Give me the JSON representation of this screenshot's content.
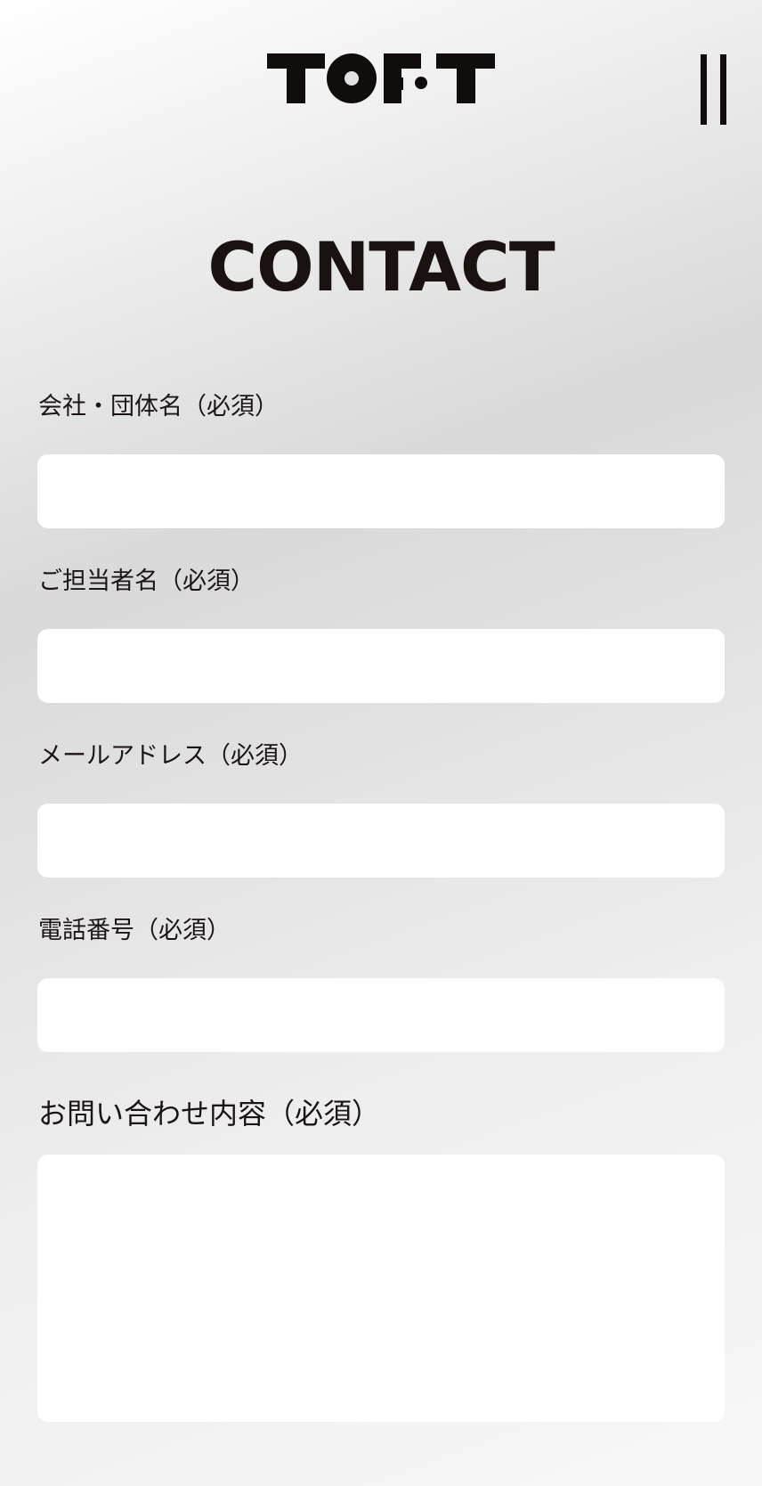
{
  "header": {
    "logo_text": "TOFT",
    "menu_icon": "menu-icon"
  },
  "page": {
    "title": "CONTACT"
  },
  "form": {
    "company": {
      "label": "会社・団体名（必須）",
      "value": "",
      "placeholder": ""
    },
    "contact_person": {
      "label": "ご担当者名（必須）",
      "value": "",
      "placeholder": ""
    },
    "email": {
      "label": "メールアドレス（必須）",
      "value": "",
      "placeholder": ""
    },
    "phone": {
      "label": "電話番号（必須）",
      "value": "",
      "placeholder": ""
    },
    "inquiry": {
      "label": "お問い合わせ内容（必須）",
      "value": "",
      "placeholder": ""
    }
  },
  "colors": {
    "text": "#1c1515",
    "field_background": "#ffffff"
  }
}
